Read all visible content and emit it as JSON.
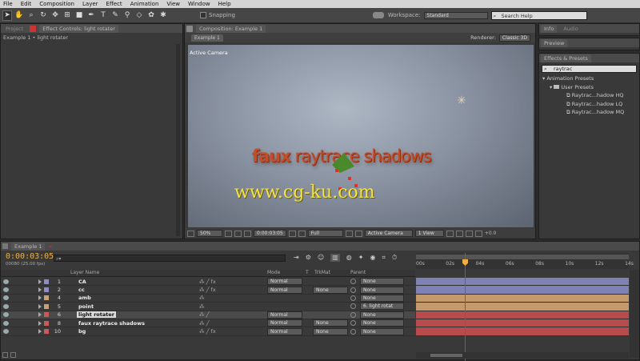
{
  "menu": [
    "File",
    "Edit",
    "Composition",
    "Layer",
    "Effect",
    "Animation",
    "View",
    "Window",
    "Help"
  ],
  "toolbar": {
    "snapping_label": "Snapping",
    "workspace_label": "Workspace:",
    "workspace_value": "Standard",
    "search_help_placeholder": "Search Help"
  },
  "left_panel": {
    "tab_project": "Project",
    "tab_effect_controls": "Effect Controls: light rotater",
    "breadcrumb": "Example 1 • light rotater"
  },
  "comp_panel": {
    "tab": "Composition: Example 1",
    "subtab": "Example 1",
    "renderer_label": "Renderer:",
    "renderer_value": "Classic 3D",
    "view_label": "Active Camera",
    "title_word1": "faux",
    "title_word2": "raytrace",
    "title_word3": "shadows",
    "watermark": "www.cg-ku.com",
    "footer": {
      "zoom": "50%",
      "timecode": "0:00:03:05",
      "resolution": "Full",
      "camera": "Active Camera",
      "views": "1 View",
      "exposure": "+0.0"
    }
  },
  "right_panel": {
    "tab_info": "Info",
    "tab_audio": "Audio",
    "preview_label": "Preview",
    "effects_title": "Effects & Presets",
    "search_value": "raytrac",
    "tree": {
      "root": "Animation Presets",
      "folder": "User Presets",
      "items": [
        "Raytrac...hadow HQ",
        "Raytrac...hadow LQ",
        "Raytrac...hadow MQ"
      ]
    }
  },
  "timeline": {
    "tab": "Example 1",
    "timecode": "0:00:03:05",
    "frame_info": "00080 (25.00 fps)",
    "col_layer_name": "Layer Name",
    "col_mode": "Mode",
    "col_t": "T",
    "col_trkmat": "TrkMat",
    "col_parent": "Parent",
    "ruler": [
      "00s",
      "02s",
      "04s",
      "06s",
      "08s",
      "10s",
      "12s",
      "14s"
    ],
    "layers": [
      {
        "num": "1",
        "name": "CA",
        "mode": "Normal",
        "trkmat": "",
        "parent": "None",
        "color": "#8c8cc8",
        "bar": "#7f82b5"
      },
      {
        "num": "2",
        "name": "cc",
        "mode": "Normal",
        "trkmat": "None",
        "parent": "None",
        "color": "#8c8cc8",
        "bar": "#7f82b5"
      },
      {
        "num": "4",
        "name": "amb",
        "mode": "",
        "trkmat": "",
        "parent": "None",
        "color": "#c8a078",
        "bar": "#c49a6c"
      },
      {
        "num": "5",
        "name": "point",
        "mode": "",
        "trkmat": "",
        "parent": "6. light rotat",
        "color": "#c8a078",
        "bar": "#c49a6c"
      },
      {
        "num": "6",
        "name": "light rotater",
        "mode": "Normal",
        "trkmat": "",
        "parent": "None",
        "color": "#c85a5a",
        "bar": "#b84c4c"
      },
      {
        "num": "8",
        "name": "faux raytrace shadows",
        "mode": "Normal",
        "trkmat": "None",
        "parent": "None",
        "color": "#c85a5a",
        "bar": "#b84c4c"
      },
      {
        "num": "10",
        "name": "bg",
        "mode": "Normal",
        "trkmat": "None",
        "parent": "None",
        "color": "#c85a5a",
        "bar": "#b84c4c"
      }
    ]
  }
}
